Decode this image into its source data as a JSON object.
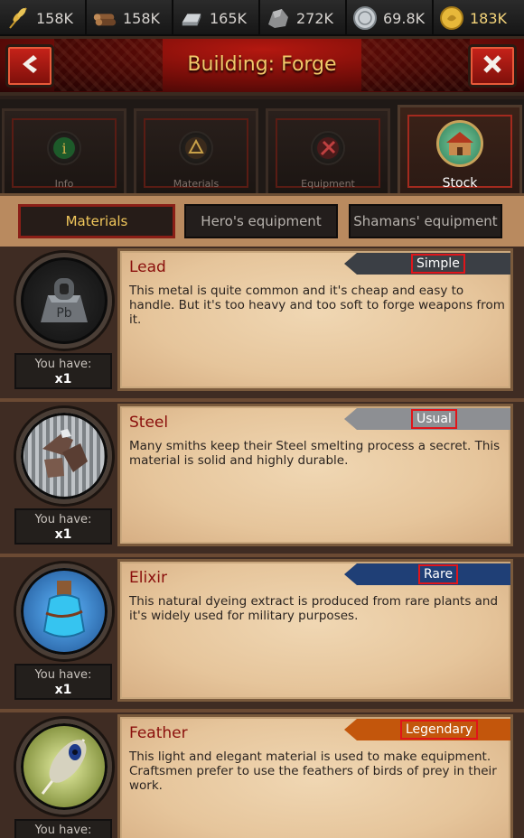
{
  "resources": [
    {
      "name": "wheat",
      "icon": "wheat-icon",
      "value": "158K"
    },
    {
      "name": "wood",
      "icon": "logs-icon",
      "value": "158K"
    },
    {
      "name": "iron",
      "icon": "ingot-icon",
      "value": "165K"
    },
    {
      "name": "stone",
      "icon": "stone-icon",
      "value": "272K"
    },
    {
      "name": "silver",
      "icon": "silver-coin-icon",
      "value": "69.8K"
    },
    {
      "name": "gold",
      "icon": "gold-coin-icon",
      "value": "183K"
    }
  ],
  "header": {
    "title": "Building: Forge"
  },
  "building_tabs": [
    {
      "label": "Info",
      "icon": "info-icon"
    },
    {
      "label": "Materials",
      "icon": "materials-icon"
    },
    {
      "label": "Equipment",
      "icon": "equipment-icon"
    },
    {
      "label": "Stock",
      "icon": "stock-house-icon",
      "active": true
    }
  ],
  "sub_tabs": [
    {
      "label": "Materials",
      "active": true
    },
    {
      "label": "Hero's equipment"
    },
    {
      "label": "Shamans' equipment"
    }
  ],
  "materials": [
    {
      "name": "Lead",
      "rarity": "Simple",
      "rarity_color": "#3b3f45",
      "description": "This metal is quite common and it's cheap and easy to handle. But it's too heavy and too soft to forge weapons from it.",
      "have_label": "You have:",
      "quantity": "x1"
    },
    {
      "name": "Steel",
      "rarity": "Usual",
      "rarity_color": "#8d8f93",
      "description": "Many smiths keep their Steel smelting process a secret. This material is solid and highly durable.",
      "have_label": "You have:",
      "quantity": "x1"
    },
    {
      "name": "Elixir",
      "rarity": "Rare",
      "rarity_color": "#1f3f76",
      "description": "This natural dyeing extract is produced from rare plants and it's widely used for military purposes.",
      "have_label": "You have:",
      "quantity": "x1"
    },
    {
      "name": "Feather",
      "rarity": "Legendary",
      "rarity_color": "#c3560c",
      "description": "This light and elegant material is used to make equipment. Craftsmen prefer to use the feathers of birds of prey in their work.",
      "have_label": "You have:",
      "quantity": ""
    }
  ]
}
